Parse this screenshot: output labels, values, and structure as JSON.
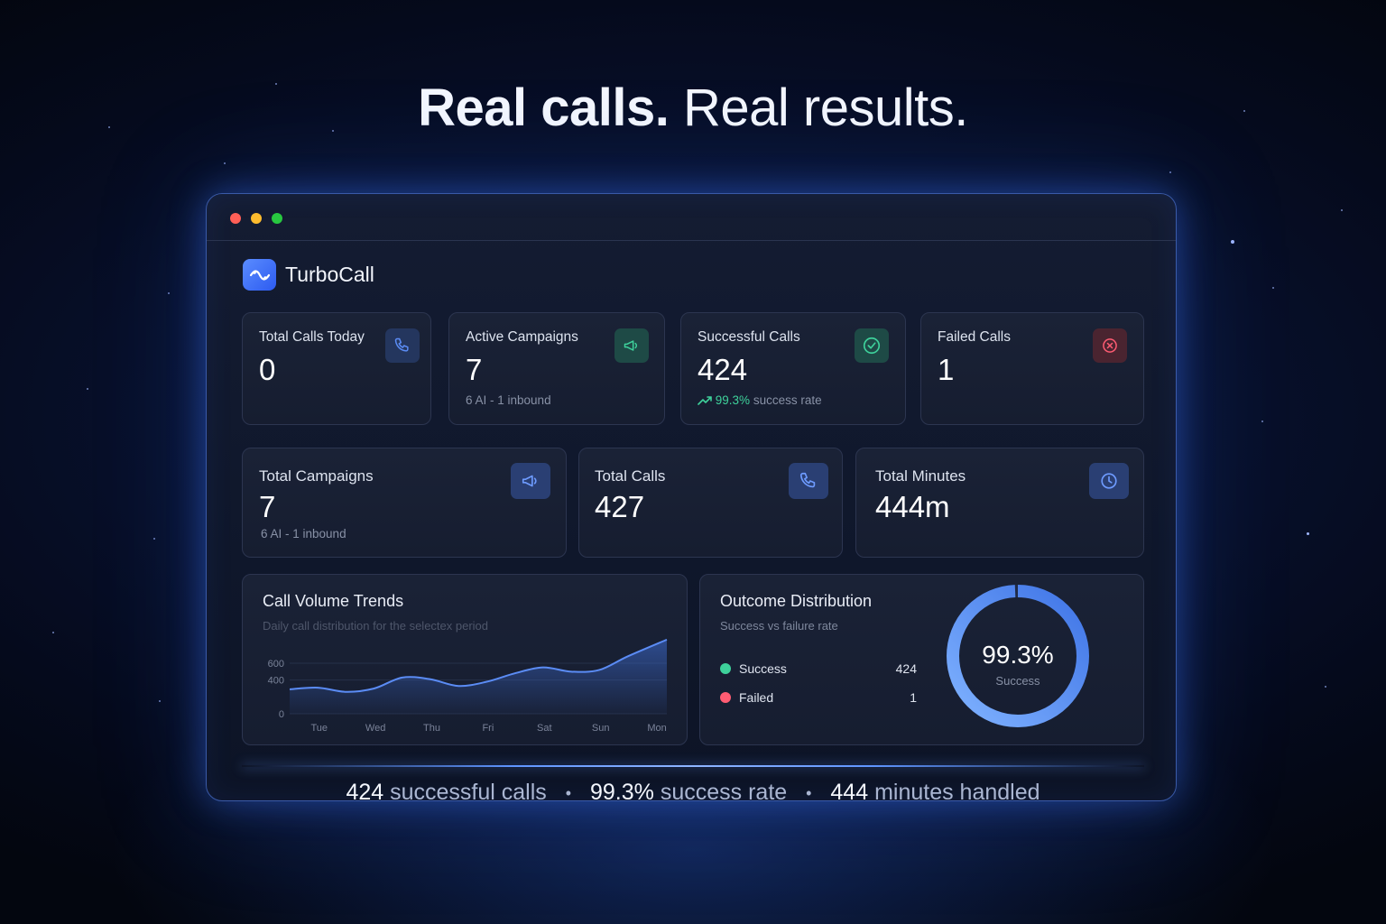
{
  "headline": {
    "bold": "Real calls.",
    "regular": "Real results."
  },
  "window": {
    "dots": [
      "#ff5f57",
      "#febc2e",
      "#28c840"
    ]
  },
  "brand": {
    "name": "TurboCall",
    "logo_icon": "waveform-icon"
  },
  "stats_row1": [
    {
      "label": "Total Calls Today",
      "value": "0",
      "icon": "phone-icon",
      "icon_color": "#5b8cf5"
    },
    {
      "label": "Active Campaigns",
      "value": "7",
      "sub": "6 AI - 1 inbound",
      "icon": "megaphone-icon",
      "icon_color": "#3ed19b"
    },
    {
      "label": "Successful Calls",
      "value": "424",
      "rate_value": "99.3%",
      "rate_text": "success rate",
      "icon": "check-circle-icon",
      "icon_color": "#3ed19b"
    },
    {
      "label": "Failed Calls",
      "value": "1",
      "icon": "x-circle-icon",
      "icon_color": "#ff5c73"
    }
  ],
  "stats_row2": [
    {
      "label": "Total Campaigns",
      "value": "7",
      "sub": "6 AI - 1 inbound",
      "icon": "megaphone-icon",
      "icon_color": "#6e9bff"
    },
    {
      "label": "Total Calls",
      "value": "427",
      "icon": "phone-icon",
      "icon_color": "#6e9bff"
    },
    {
      "label": "Total Minutes",
      "value": "444m",
      "icon": "clock-icon",
      "icon_color": "#6e9bff"
    }
  ],
  "volume_panel": {
    "title": "Call Volume Trends",
    "subtitle": "Daily call distribution for the selectex period"
  },
  "chart_data": {
    "type": "area",
    "title": "Call Volume Trends",
    "categories": [
      "Tue",
      "Wed",
      "Thu",
      "Fri",
      "Sat",
      "Sun",
      "Mon"
    ],
    "x": [
      0,
      0.5,
      1,
      1.5,
      2,
      2.5,
      3,
      3.5,
      4,
      4.5,
      5,
      5.5,
      6,
      6.7
    ],
    "values": [
      290,
      310,
      260,
      300,
      430,
      410,
      330,
      380,
      480,
      550,
      500,
      520,
      680,
      880
    ],
    "ylim": [
      0,
      900
    ],
    "yticks": [
      "0",
      "400",
      "600"
    ],
    "color": "#5b8cf5",
    "grid": true
  },
  "outcome_panel": {
    "title": "Outcome Distribution",
    "subtitle": "Success vs failure rate",
    "legend": [
      {
        "label": "Success",
        "value": "424",
        "color": "#3ed19b"
      },
      {
        "label": "Failed",
        "value": "1",
        "color": "#ff5c73"
      }
    ],
    "donut_percent": "99.3%",
    "donut_caption": "Success",
    "donut_fraction": 0.993
  },
  "bottom_stats": [
    {
      "num": "424",
      "text": "successful calls"
    },
    {
      "num": "99.3%",
      "text": "success rate"
    },
    {
      "num": "444",
      "text": "minutes handled"
    }
  ]
}
